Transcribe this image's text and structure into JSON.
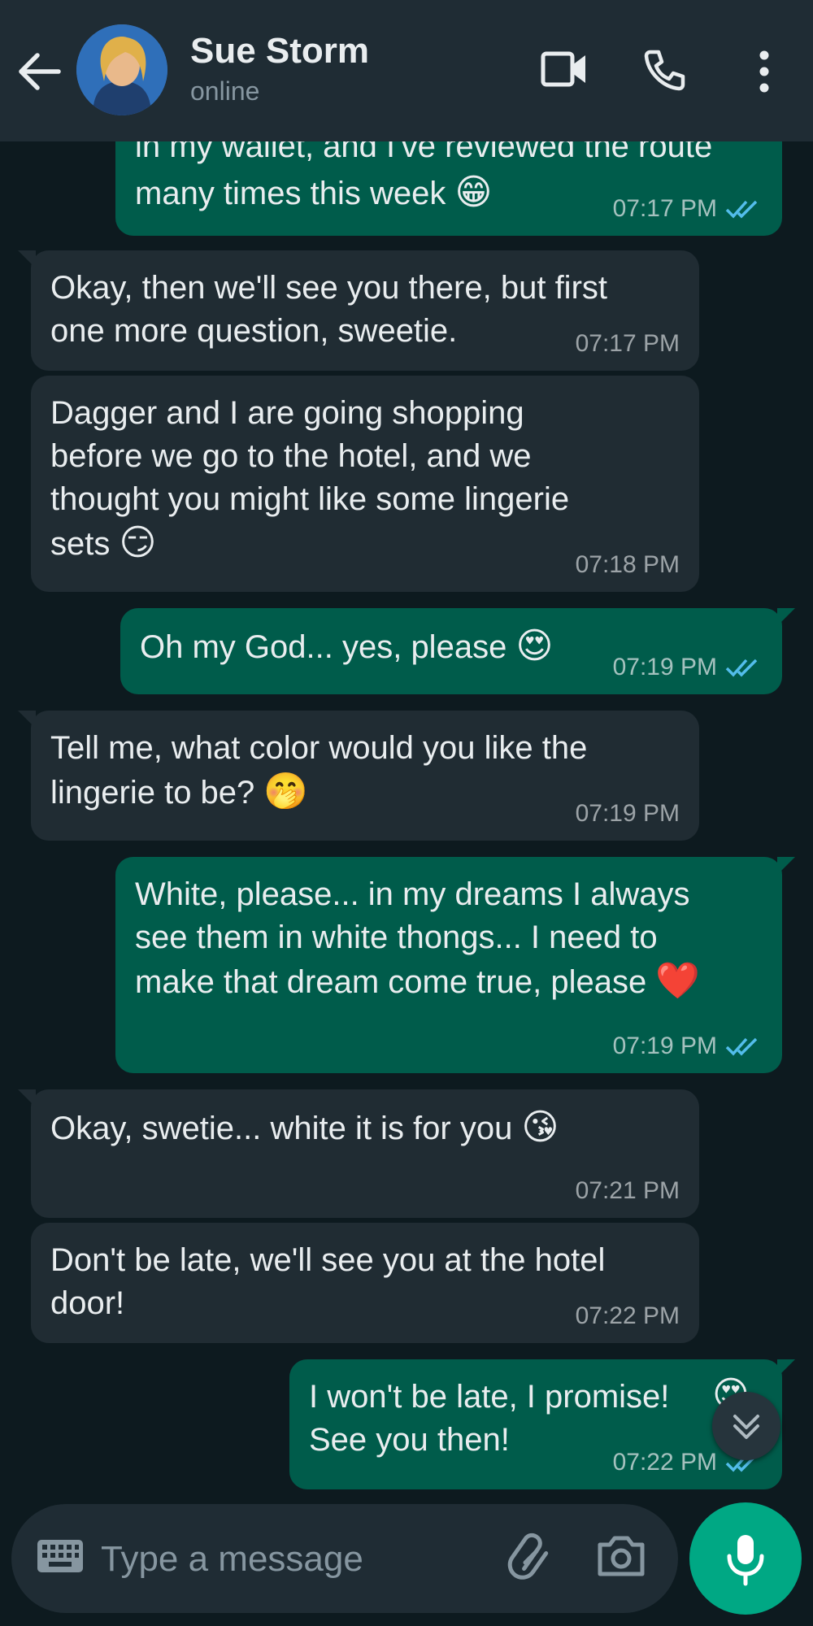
{
  "header": {
    "contact_name": "Sue Storm",
    "contact_status": "online",
    "icons": [
      "back-arrow-icon",
      "video-call-icon",
      "voice-call-icon",
      "more-options-icon"
    ]
  },
  "messages": [
    {
      "direction": "out",
      "text": "in my wallet, and I've reviewed the route",
      "text2": "many times this week",
      "emoji": "😁",
      "time": "07:17 PM",
      "status": "read"
    },
    {
      "direction": "in",
      "text": "Okay, then we'll see you there, but first\none more question, sweetie.",
      "time": "07:17 PM"
    },
    {
      "direction": "in",
      "text": "Dagger and I are going shopping\nbefore we go to the hotel, and we\nthought you might like some lingerie\nsets",
      "emoji": "😏",
      "time": "07:18 PM"
    },
    {
      "direction": "out",
      "text": "Oh my God... yes, please",
      "emoji": "😍",
      "time": "07:19 PM",
      "status": "read"
    },
    {
      "direction": "in",
      "text": "Tell me, what color would you like the\nlingerie to be?",
      "emoji": "🤭",
      "time": "07:19 PM"
    },
    {
      "direction": "out",
      "text": "White, please... in my dreams I always\nsee them in white thongs... I need to\nmake that dream come true, please",
      "emoji": "❤️",
      "time": "07:19 PM",
      "status": "read"
    },
    {
      "direction": "in",
      "text": "Okay, swetie... white it is for you",
      "emoji": "😘",
      "time": "07:21 PM"
    },
    {
      "direction": "in",
      "text": "Don't be late, we'll see you at the hotel\ndoor!",
      "time": "07:22 PM"
    },
    {
      "direction": "out",
      "text": "I won't be late, I promise!\nSee you then!",
      "emoji": "😍",
      "time": "07:22 PM",
      "status": "read"
    }
  ],
  "composer": {
    "placeholder": "Type a message",
    "icons": [
      "keyboard-icon",
      "attach-icon",
      "camera-icon",
      "microphone-icon"
    ]
  },
  "colors": {
    "incoming_bubble": "#202c33",
    "outgoing_bubble": "#005c4b",
    "accent": "#00a884",
    "read_ticks": "#53bdeb"
  }
}
